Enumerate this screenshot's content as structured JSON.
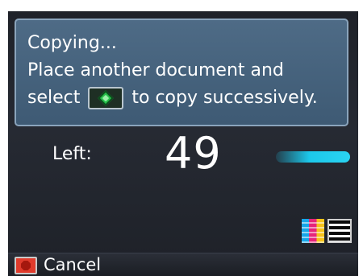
{
  "message": {
    "line1": "Copying...",
    "line2": "Place another document and",
    "line3_before": "select",
    "line3_after": "to copy successively."
  },
  "counter": {
    "label": "Left:",
    "value": "49"
  },
  "icons": {
    "start": "start-button-icon",
    "color_mode": "color-copy-icon",
    "bw_mode": "black-white-copy-icon",
    "stop": "stop-button-icon"
  },
  "footer": {
    "cancel_label": "Cancel"
  },
  "colors": {
    "message_box": "#4e6b86",
    "progress": "#1cc8ea",
    "start_green": "#27c14a",
    "stop_red": "#e03b2c"
  }
}
